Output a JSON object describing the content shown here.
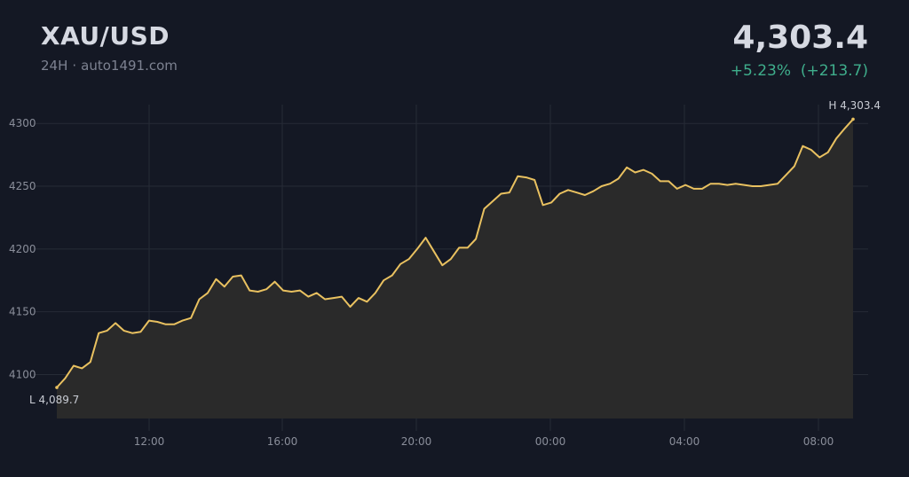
{
  "header": {
    "symbol": "XAU/USD",
    "period": "24H",
    "separator": "·",
    "source": "auto1491.com",
    "price": "4,303.4",
    "change_pct": "+5.23%",
    "change_abs": "(+213.7)"
  },
  "colors": {
    "background": "#141824",
    "line": "#e9c160",
    "fill": "#2a2a2a",
    "grid": "#262b36",
    "positive": "#3fae8c"
  },
  "chart_data": {
    "type": "area",
    "title": "XAU/USD",
    "ylim": [
      4065,
      4315
    ],
    "yticks": [
      4100,
      4150,
      4200,
      4250,
      4300
    ],
    "xticks": [
      "12:00",
      "16:00",
      "20:00",
      "00:00",
      "04:00",
      "08:00"
    ],
    "grid": true,
    "low_label": "L 4,089.7",
    "high_label": "H 4,303.4",
    "values": [
      4089.7,
      4097,
      4107,
      4105,
      4110,
      4133,
      4135,
      4141,
      4135,
      4133,
      4134,
      4143,
      4142,
      4140,
      4140,
      4143,
      4145,
      4160,
      4165,
      4176,
      4170,
      4178,
      4179,
      4167,
      4166,
      4168,
      4174,
      4167,
      4166,
      4167,
      4162,
      4165,
      4160,
      4161,
      4162,
      4154,
      4161,
      4158,
      4165,
      4175,
      4179,
      4188,
      4192,
      4200,
      4209,
      4198,
      4187,
      4192,
      4201,
      4201,
      4208,
      4232,
      4238,
      4244,
      4245,
      4258,
      4257,
      4255,
      4235,
      4237,
      4244,
      4247,
      4245,
      4243,
      4246,
      4250,
      4252,
      4256,
      4265,
      4261,
      4263,
      4260,
      4254,
      4254,
      4248,
      4251,
      4248,
      4248,
      4252,
      4252,
      4251,
      4252,
      4251,
      4250,
      4250,
      4251,
      4252,
      4259,
      4266,
      4282,
      4279,
      4273,
      4277,
      4288,
      4296,
      4303.4
    ]
  }
}
